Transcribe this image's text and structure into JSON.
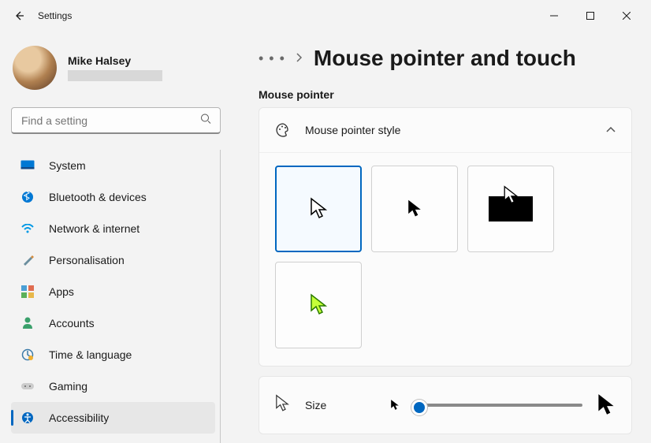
{
  "window": {
    "title": "Settings"
  },
  "profile": {
    "name": "Mike Halsey"
  },
  "search": {
    "placeholder": "Find a setting"
  },
  "nav": {
    "items": [
      {
        "id": "system",
        "label": "System"
      },
      {
        "id": "bluetooth",
        "label": "Bluetooth & devices"
      },
      {
        "id": "network",
        "label": "Network & internet"
      },
      {
        "id": "personalisation",
        "label": "Personalisation"
      },
      {
        "id": "apps",
        "label": "Apps"
      },
      {
        "id": "accounts",
        "label": "Accounts"
      },
      {
        "id": "time",
        "label": "Time & language"
      },
      {
        "id": "gaming",
        "label": "Gaming"
      },
      {
        "id": "accessibility",
        "label": "Accessibility",
        "selected": true
      }
    ]
  },
  "breadcrumb": {
    "dots": "• • •",
    "title": "Mouse pointer and touch"
  },
  "section": {
    "mouse_pointer": "Mouse pointer"
  },
  "style_card": {
    "title": "Mouse pointer style",
    "options": [
      "white",
      "black",
      "inverted",
      "custom"
    ],
    "selected": "white"
  },
  "size_card": {
    "label": "Size"
  }
}
